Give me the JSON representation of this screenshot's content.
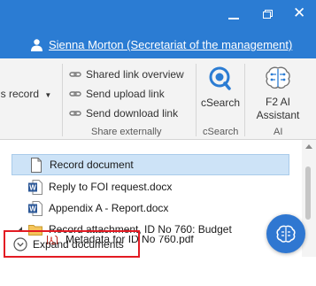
{
  "window": {
    "user": "Sienna Morton (Secretariat of the management)",
    "controls": [
      "minimize",
      "restore",
      "close"
    ]
  },
  "ribbon": {
    "record_menu": "is record",
    "share_externally": {
      "items": [
        "Shared link overview",
        "Send upload link",
        "Send download link"
      ],
      "group_label": "Share externally"
    },
    "csearch": {
      "button_label": "cSearch",
      "group_label": "cSearch"
    },
    "ai": {
      "button_label_line1": "F2 AI",
      "button_label_line2": "Assistant",
      "group_label": "AI"
    }
  },
  "tree": {
    "items": [
      {
        "label": "Record document",
        "icon": "document-icon",
        "selected": true
      },
      {
        "label": "Reply to FOI request.docx",
        "icon": "word-doc-icon"
      },
      {
        "label": "Appendix A - Report.docx",
        "icon": "word-doc-icon"
      },
      {
        "label": "Record attachment, ID No 760: Budget",
        "icon": "folder-icon",
        "expanded": true
      },
      {
        "label": "Metadata for ID No 760.pdf",
        "icon": "pdf-icon"
      }
    ]
  },
  "footer": {
    "expand_label": "Expand documents"
  },
  "colors": {
    "titlebar": "#2b7cd3",
    "selection": "#cde3f7",
    "highlight_box": "#e31b23",
    "fab": "#2f77d1"
  }
}
